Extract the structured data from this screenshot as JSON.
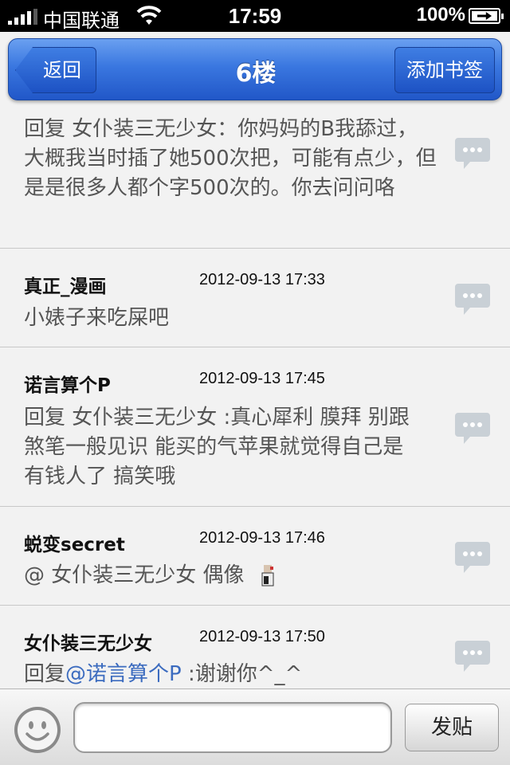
{
  "status_bar": {
    "carrier": "中国联通",
    "time": "17:59",
    "battery": "100%"
  },
  "nav": {
    "back_label": "返回",
    "title": "6楼",
    "bookmark_label": "添加书签"
  },
  "posts": [
    {
      "author": "",
      "time": "",
      "text": "回复 女仆装三无少女：你妈妈的B我舔过，大概我当时插了她500次把，可能有点少，但是是很多人都个字500次的。你去问问咯"
    },
    {
      "author": "真正_漫画",
      "time": "2012-09-13 17:33",
      "text": "小婊子来吃屎吧"
    },
    {
      "author": "诺言算个P",
      "time": "2012-09-13 17:45",
      "text": "回复 女仆装三无少女 :真心犀利 膜拜 别跟煞笔一般见识 能买的气苹果就觉得自己是有钱人了 搞笑哦"
    },
    {
      "author": "蜕变secret",
      "time": "2012-09-13 17:46",
      "text": "@ 女仆装三无少女 偶像"
    },
    {
      "author": "女仆装三无少女",
      "time": "2012-09-13 17:50",
      "text_prefix": "回复",
      "mention": "@诺言算个P",
      "text_suffix": " :谢谢你^_^"
    }
  ],
  "composer": {
    "placeholder": "",
    "submit_label": "发贴"
  },
  "colors": {
    "nav_blue": "#2a66d6",
    "link_blue": "#3b6bbf"
  },
  "icons": [
    "signal-icon",
    "wifi-icon",
    "battery-icon",
    "reply-bubble-icon",
    "smiley-icon"
  ]
}
